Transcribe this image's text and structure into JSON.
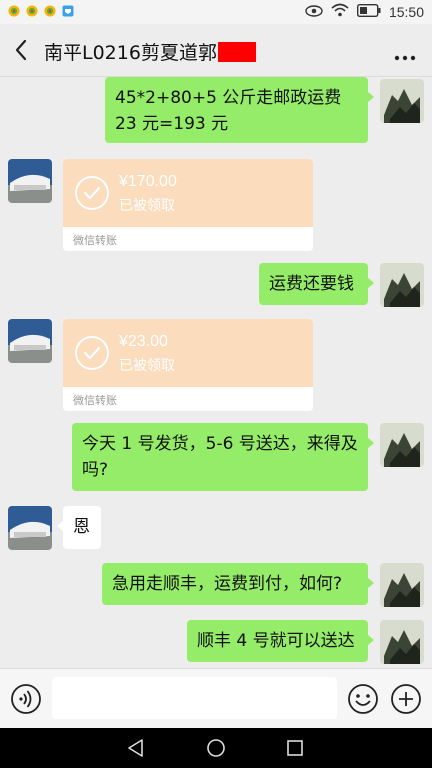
{
  "status_bar": {
    "time": "15:50",
    "icons": [
      "app-icon",
      "app-icon",
      "app-icon",
      "shield-icon",
      "eye-icon",
      "wifi-icon",
      "battery-icon"
    ]
  },
  "chat": {
    "title": "南平L0216剪夏道郭",
    "messages": [
      {
        "side": "out",
        "text": "45*2+80+5 公斤走邮政运费 23 元=193 元"
      },
      {
        "side": "in",
        "type": "transfer",
        "amount": "¥170.00",
        "status": "已被领取",
        "label": "微信转账"
      },
      {
        "side": "out",
        "text": "运费还要钱"
      },
      {
        "side": "in",
        "type": "transfer",
        "amount": "¥23.00",
        "status": "已被领取",
        "label": "微信转账"
      },
      {
        "side": "out",
        "text": "今天 1 号发货，5-6 号送达，来得及吗?"
      },
      {
        "side": "in",
        "text": "恩"
      },
      {
        "side": "out",
        "text": "急用走顺丰，运费到付，如何?"
      },
      {
        "side": "out",
        "text": "顺丰 4 号就可以送达"
      }
    ]
  },
  "colors": {
    "outgoing_bubble": "#95ec69",
    "transfer_card": "#fbdcbd",
    "background": "#ededed",
    "redaction": "#ff0000"
  }
}
